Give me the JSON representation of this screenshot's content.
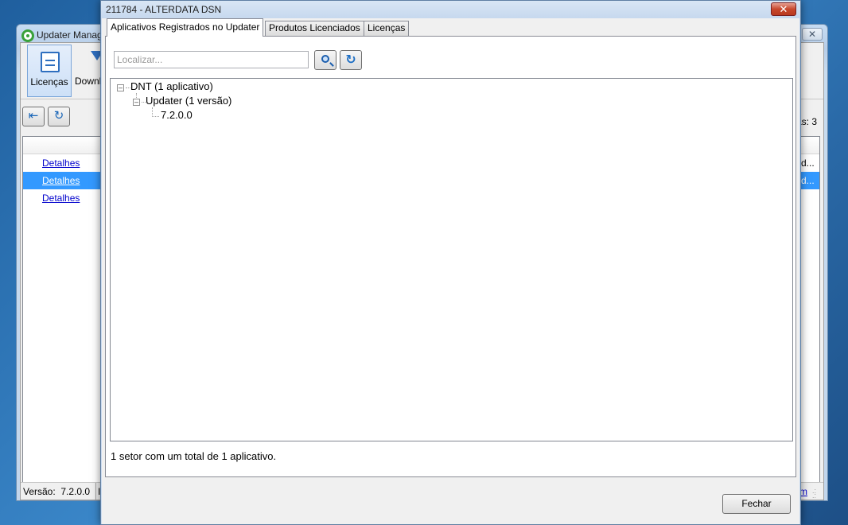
{
  "bg_window": {
    "title": "Updater Manag",
    "ribbon_licencas": "Licenças",
    "ribbon_download": "Downl",
    "count_text": "as: 3",
    "rows": [
      {
        "link": "Detalhes",
        "right": "d...",
        "selected": false
      },
      {
        "link": "Detalhes",
        "right": "d...",
        "selected": true
      },
      {
        "link": "Detalhes",
        "right": "",
        "selected": false
      }
    ],
    "status_version_label": "Versão:",
    "status_version_value": "7.2.0.0",
    "status_ip": "IP",
    "status_link": "m"
  },
  "dialog": {
    "title": "211784 - ALTERDATA DSN",
    "close_glyph": "✕",
    "tabs": [
      {
        "label": "Aplicativos Registrados no Updater",
        "active": true
      },
      {
        "label": "Produtos Licenciados",
        "active": false
      },
      {
        "label": "Licenças",
        "active": false
      }
    ],
    "search_placeholder": "Localizar...",
    "tree": {
      "root": "DNT (1 aplicativo)",
      "child": "Updater (1 versão)",
      "leaf": "7.2.0.0"
    },
    "summary": "1 setor com um total de 1 aplicativo.",
    "close_button": "Fechar"
  },
  "colors": {
    "selection": "#3399ff",
    "link": "#0000cc",
    "close_red": "#c7472c"
  }
}
